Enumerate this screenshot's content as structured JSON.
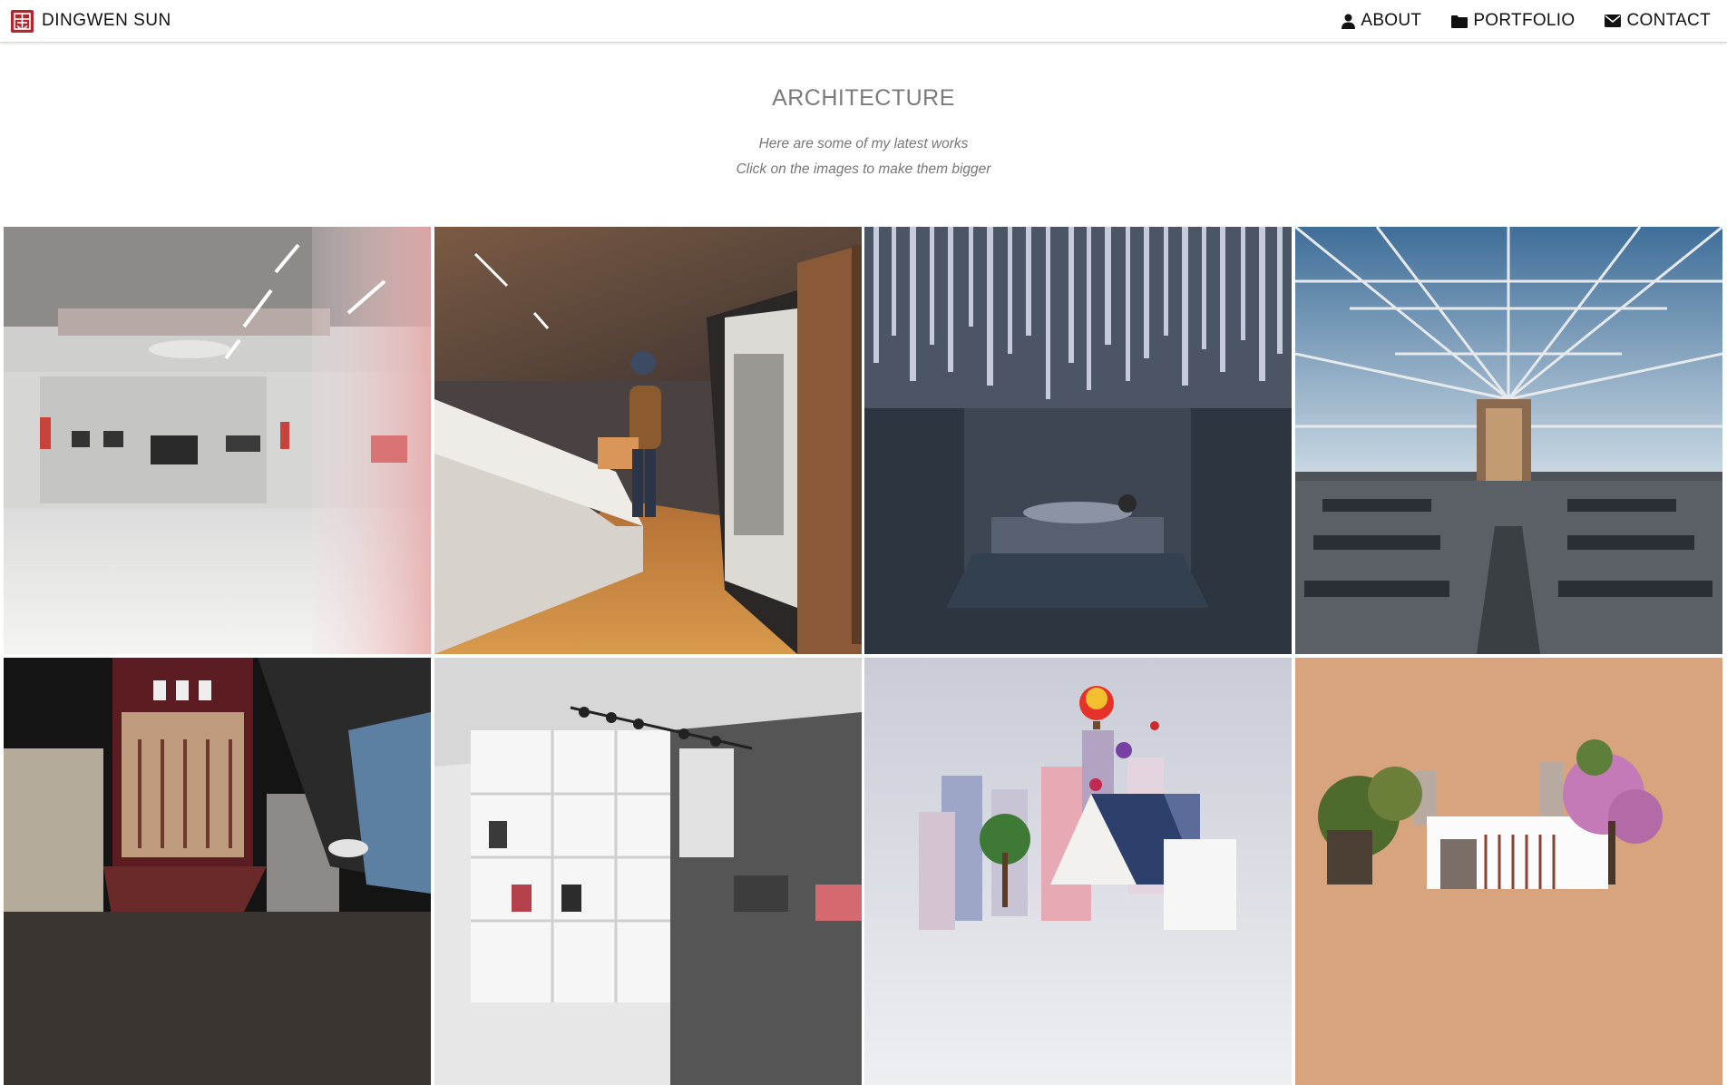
{
  "navbar": {
    "brand_name": "DINGWEN SUN",
    "logo_icon": "seal-logo",
    "links": [
      {
        "label": "ABOUT",
        "icon": "user-icon"
      },
      {
        "label": "PORTFOLIO",
        "icon": "folder-icon"
      },
      {
        "label": "CONTACT",
        "icon": "envelope-icon"
      }
    ]
  },
  "header": {
    "title": "ARCHITECTURE",
    "subtitle_1": "Here are some of my latest works",
    "subtitle_2": "Click on the images to make them bigger"
  },
  "colors": {
    "logo_red": "#b0272d",
    "title_gray": "#7b7b7b",
    "subtitle_gray": "#777777"
  },
  "gallery": {
    "images": [
      {
        "name": "white-gallery-interior"
      },
      {
        "name": "exhibition-corridor-wood-floor"
      },
      {
        "name": "suspended-rods-installation"
      },
      {
        "name": "glass-roof-dining-hall"
      },
      {
        "name": "hanging-red-frame-lobby"
      },
      {
        "name": "furniture-showroom"
      },
      {
        "name": "hot-air-balloon-collage"
      },
      {
        "name": "trees-pavilion-collage"
      }
    ]
  }
}
